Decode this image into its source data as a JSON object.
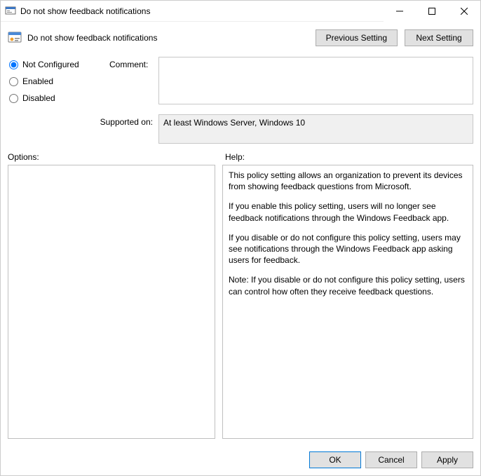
{
  "window": {
    "title": "Do not show feedback notifications"
  },
  "toolbar": {
    "heading": "Do not show feedback notifications",
    "previous": "Previous Setting",
    "next": "Next Setting"
  },
  "state": {
    "options": {
      "not_configured": "Not Configured",
      "enabled": "Enabled",
      "disabled": "Disabled"
    },
    "selected": "not_configured"
  },
  "labels": {
    "comment": "Comment:",
    "supported_on": "Supported on:",
    "options": "Options:",
    "help": "Help:"
  },
  "comment": "",
  "supported_on": "At least Windows Server, Windows 10",
  "help": {
    "p1": "This policy setting allows an organization to prevent its devices from showing feedback questions from Microsoft.",
    "p2": "If you enable this policy setting, users will no longer see feedback notifications through the Windows Feedback app.",
    "p3": "If you disable or do not configure this policy setting, users may see notifications through the Windows Feedback app asking users for feedback.",
    "p4": "Note: If you disable or do not configure this policy setting, users can control how often they receive feedback questions."
  },
  "footer": {
    "ok": "OK",
    "cancel": "Cancel",
    "apply": "Apply"
  }
}
